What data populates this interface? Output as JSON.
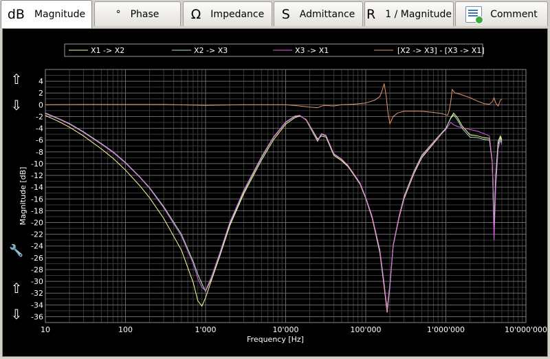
{
  "tabs": [
    {
      "symbol": "dB",
      "label": "Magnitude",
      "active": true
    },
    {
      "symbol": "°",
      "label": "Phase",
      "active": false
    },
    {
      "symbol": "Ω",
      "label": "Impedance",
      "active": false
    },
    {
      "symbol": "S",
      "label": "Admittance",
      "active": false
    },
    {
      "symbol": "R",
      "label": "1 / Magnitude",
      "active": false
    },
    {
      "symbol": "comment-icon",
      "label": "Comment",
      "active": false
    }
  ],
  "side_controls": [
    {
      "icon": "arrow-up-icon",
      "glyph": "⇧"
    },
    {
      "icon": "arrow-down-icon",
      "glyph": "⇩"
    },
    {
      "icon": "wrench-icon",
      "glyph": "🔧"
    },
    {
      "icon": "arrow-up-icon",
      "glyph": "⇧"
    },
    {
      "icon": "arrow-down-icon",
      "glyph": "⇩"
    }
  ],
  "colors": {
    "background": "#000000",
    "grid_major": "#6b6b6b",
    "grid_minor": "#3a3a3a",
    "text": "#ffffff"
  },
  "chart_data": {
    "type": "line",
    "xlabel": "Frequency [Hz]",
    "ylabel": "Magnitude [dB]",
    "xscale": "log",
    "xlim": [
      10,
      10000000
    ],
    "ylim": [
      -37,
      6
    ],
    "x_ticks": [
      10,
      100,
      1000,
      10000,
      100000,
      1000000,
      10000000
    ],
    "x_tick_labels": [
      "10",
      "100",
      "1'000",
      "10'000",
      "100'000",
      "1'000'000",
      "10'000'000"
    ],
    "y_ticks": [
      4,
      2,
      0,
      -2,
      -4,
      -6,
      -8,
      -10,
      -12,
      -14,
      -16,
      -18,
      -20,
      -22,
      -24,
      -26,
      -28,
      -30,
      -32,
      -34,
      -36
    ],
    "grid": true,
    "legend_position": "top",
    "series": [
      {
        "name": "X1 -> X2",
        "color": "#ffff99",
        "x": [
          10,
          15,
          20,
          30,
          50,
          70,
          100,
          150,
          200,
          300,
          500,
          700,
          800,
          900,
          1000,
          1200,
          1500,
          2000,
          3000,
          5000,
          7000,
          10000,
          13000,
          15000,
          18000,
          22000,
          25000,
          28000,
          32000,
          40000,
          50000,
          60000,
          70000,
          85000,
          100000,
          120000,
          150000,
          170000,
          185000,
          200000,
          220000,
          260000,
          300000,
          400000,
          500000,
          700000,
          1000000,
          1150000,
          1250000,
          1400000,
          1600000,
          2000000,
          2500000,
          3000000,
          3500000,
          3800000,
          4000000,
          4200000,
          4500000,
          4800000,
          5000000
        ],
        "y": [
          -1.8,
          -2.9,
          -3.8,
          -5.3,
          -7.5,
          -9.1,
          -11.1,
          -13.7,
          -15.8,
          -19.3,
          -24.7,
          -30.2,
          -33.3,
          -34.2,
          -32.8,
          -29.6,
          -25.8,
          -20.6,
          -15.1,
          -9.4,
          -6.0,
          -3.3,
          -2.2,
          -1.9,
          -2.5,
          -4.5,
          -5.8,
          -5.3,
          -5.5,
          -8.6,
          -9.5,
          -10.5,
          -11.8,
          -13.5,
          -15.9,
          -19.2,
          -25.1,
          -31.0,
          -35.3,
          -31.0,
          -24.0,
          -19.3,
          -16.0,
          -11.7,
          -9.0,
          -6.6,
          -4.1,
          -2.2,
          -1.4,
          -2.2,
          -3.6,
          -5.1,
          -5.3,
          -5.6,
          -5.7,
          -9.8,
          -21.5,
          -12.0,
          -6.2,
          -5.3,
          -6.0
        ]
      },
      {
        "name": "X2 -> X3",
        "color": "#a8f0c8",
        "x": [
          10,
          15,
          20,
          30,
          50,
          70,
          100,
          150,
          200,
          300,
          500,
          700,
          800,
          900,
          1000,
          1200,
          1500,
          2000,
          3000,
          5000,
          7000,
          10000,
          13000,
          15000,
          18000,
          22000,
          25000,
          28000,
          32000,
          40000,
          50000,
          60000,
          70000,
          85000,
          100000,
          120000,
          150000,
          170000,
          185000,
          200000,
          220000,
          260000,
          300000,
          400000,
          500000,
          700000,
          1000000,
          1150000,
          1250000,
          1400000,
          1600000,
          2000000,
          2500000,
          3000000,
          3500000,
          3800000,
          4000000,
          4200000,
          4500000,
          4800000,
          5000000
        ],
        "y": [
          -1.4,
          -2.4,
          -3.2,
          -4.6,
          -6.6,
          -8.0,
          -9.8,
          -12.2,
          -14.1,
          -17.3,
          -22.0,
          -26.6,
          -28.8,
          -30.4,
          -31.7,
          -29.4,
          -25.6,
          -20.3,
          -14.8,
          -9.0,
          -5.6,
          -3.0,
          -2.0,
          -1.8,
          -2.6,
          -4.8,
          -6.2,
          -5.0,
          -5.3,
          -8.4,
          -9.3,
          -10.4,
          -11.7,
          -13.4,
          -15.8,
          -19.0,
          -24.8,
          -30.6,
          -34.6,
          -30.5,
          -23.8,
          -19.0,
          -15.6,
          -11.3,
          -8.6,
          -6.3,
          -4.0,
          -2.3,
          -1.7,
          -2.6,
          -4.0,
          -5.5,
          -5.6,
          -5.9,
          -6.0,
          -9.6,
          -20.5,
          -12.2,
          -6.8,
          -5.6,
          -6.4
        ]
      },
      {
        "name": "X3 -> X1",
        "color": "#e060e0",
        "x": [
          10,
          15,
          20,
          30,
          50,
          70,
          100,
          150,
          200,
          300,
          500,
          700,
          800,
          900,
          1000,
          1200,
          1500,
          2000,
          3000,
          5000,
          7000,
          10000,
          13000,
          15000,
          18000,
          22000,
          25000,
          28000,
          32000,
          40000,
          50000,
          60000,
          70000,
          85000,
          100000,
          120000,
          150000,
          170000,
          185000,
          200000,
          220000,
          260000,
          300000,
          400000,
          500000,
          700000,
          1000000,
          1150000,
          1250000,
          1400000,
          1600000,
          2000000,
          2500000,
          3000000,
          3500000,
          3800000,
          4000000,
          4200000,
          4500000,
          4800000,
          5000000
        ],
        "y": [
          -1.5,
          -2.5,
          -3.3,
          -4.7,
          -6.7,
          -8.1,
          -9.9,
          -12.3,
          -14.2,
          -17.5,
          -22.3,
          -27.0,
          -29.5,
          -31.0,
          -31.6,
          -29.0,
          -25.2,
          -20.0,
          -14.5,
          -8.8,
          -5.5,
          -2.9,
          -1.9,
          -1.8,
          -2.6,
          -4.6,
          -6.0,
          -4.9,
          -5.2,
          -8.3,
          -9.2,
          -10.3,
          -11.6,
          -13.3,
          -15.7,
          -18.9,
          -24.6,
          -30.3,
          -35.0,
          -30.8,
          -23.9,
          -19.1,
          -15.8,
          -11.5,
          -8.8,
          -6.4,
          -4.2,
          -3.0,
          -3.4,
          -3.7,
          -3.9,
          -4.2,
          -4.5,
          -4.9,
          -5.3,
          -9.5,
          -23.0,
          -14.0,
          -7.5,
          -6.0,
          -6.8
        ]
      },
      {
        "name": "[X2 -> X3] - [X3 -> X1]",
        "color": "#e8956a",
        "x": [
          10,
          30,
          100,
          300,
          1000,
          3000,
          10000,
          15000,
          20000,
          25000,
          30000,
          40000,
          50000,
          70000,
          100000,
          130000,
          150000,
          160000,
          170000,
          180000,
          190000,
          200000,
          220000,
          250000,
          300000,
          400000,
          500000,
          700000,
          900000,
          1050000,
          1100000,
          1150000,
          1200000,
          1300000,
          1500000,
          2000000,
          2500000,
          3000000,
          3500000,
          3800000,
          4000000,
          4200000,
          4500000,
          4800000,
          5000000
        ],
        "y": [
          0,
          0.05,
          0.05,
          0.05,
          -0.1,
          0,
          0,
          -0.2,
          -0.4,
          -0.5,
          -0.1,
          -0.2,
          0,
          0.1,
          0.3,
          0.8,
          1.4,
          2.4,
          3.6,
          1.5,
          -1.5,
          -3.2,
          -2.0,
          -1.4,
          -1.1,
          -1.1,
          -1.1,
          -1.3,
          -1.5,
          -1.8,
          -1.0,
          0.5,
          2.6,
          2.0,
          1.8,
          1.2,
          0.6,
          0.2,
          0.1,
          0.5,
          1.2,
          0.3,
          -0.2,
          0.8,
          1.0
        ]
      }
    ]
  }
}
